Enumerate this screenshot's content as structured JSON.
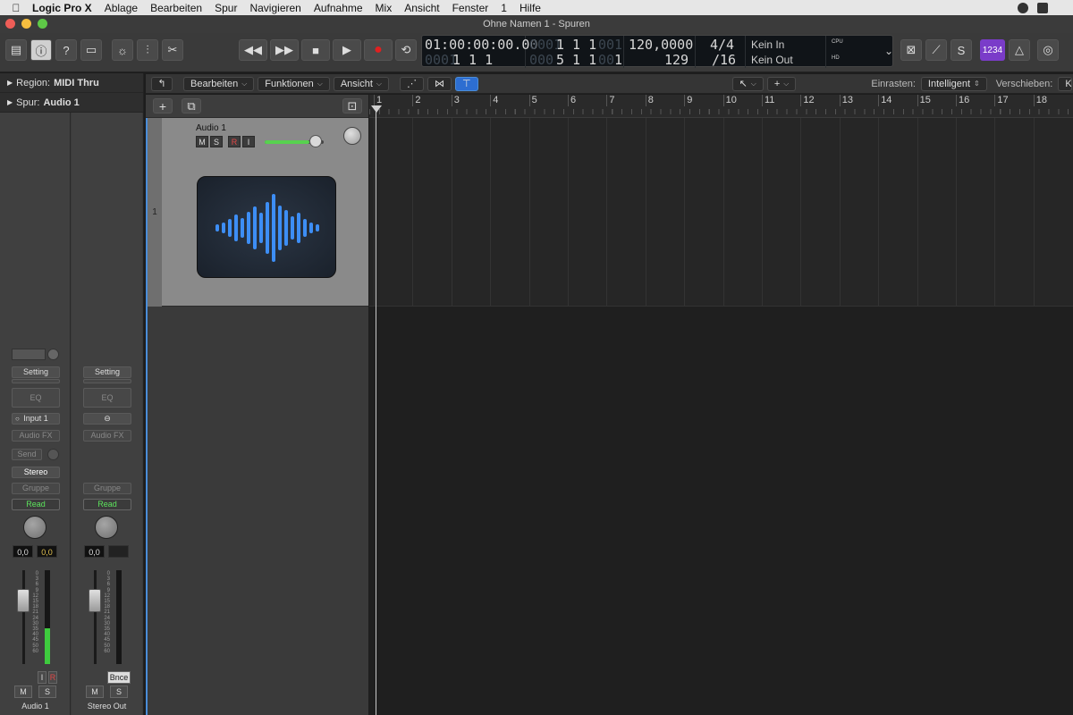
{
  "menubar": {
    "app_name": "Logic Pro X",
    "items": [
      "Ablage",
      "Bearbeiten",
      "Spur",
      "Navigieren",
      "Aufnahme",
      "Mix",
      "Ansicht",
      "Fenster",
      "1",
      "Hilfe"
    ]
  },
  "window": {
    "title": "Ohne Namen 1 - Spuren"
  },
  "lcd": {
    "timecode": "01:00:00:00.00",
    "position_top_dim": "0001",
    "position_top": "1  1  1",
    "position_top_sub": "001",
    "position_bottom": "1  1  1",
    "position_bottom_sub_dim": "00",
    "position_bottom_sub": "1",
    "end_bottom_dim": "000",
    "end_bottom": "5  1  1",
    "end_bottom_sub_dim": "00",
    "end_bottom_sub": "1",
    "tempo": "120,0000",
    "tempo_bottom": "129",
    "signature": "4/4",
    "division": "/16",
    "midi_in": "Kein In",
    "midi_out": "Kein Out",
    "cpu_label": "CPU",
    "hd_label": "HD"
  },
  "control_bar": {
    "count_in": "1234"
  },
  "inspector": {
    "region_label": "Region:",
    "region_value": "MIDI Thru",
    "track_label": "Spur:",
    "track_value": "Audio 1",
    "strip1": {
      "setting": "Setting",
      "eq": "EQ",
      "input": "Input 1",
      "audio_fx": "Audio FX",
      "send": "Send",
      "stereo": "Stereo",
      "group": "Gruppe",
      "automation": "Read",
      "value_left": "0,0",
      "value_right": "0,0",
      "input_monitor": "I",
      "record": "R",
      "mute": "M",
      "solo": "S",
      "name": "Audio 1"
    },
    "strip2": {
      "setting": "Setting",
      "eq": "EQ",
      "audio_fx": "Audio FX",
      "group": "Gruppe",
      "automation": "Read",
      "value_left": "0,0",
      "bounce": "Bnce",
      "mute": "M",
      "solo": "S",
      "name": "Stereo Out"
    },
    "meter_scale": [
      "0",
      "3",
      "6",
      "9",
      "12",
      "15",
      "18",
      "21",
      "24",
      "30",
      "35",
      "40",
      "45",
      "50",
      "60"
    ]
  },
  "tracks_toolbar": {
    "edit": "Bearbeiten",
    "functions": "Funktionen",
    "view": "Ansicht",
    "snap_label": "Einrasten:",
    "snap_value": "Intelligent",
    "drag_label": "Verschieben:",
    "drag_value": "Keine Üb"
  },
  "track": {
    "number": "1",
    "name": "Audio 1",
    "mute": "M",
    "solo": "S",
    "record": "R",
    "input": "I",
    "volume": 0.75
  },
  "ruler": {
    "bars": [
      "1",
      "2",
      "3",
      "4",
      "5",
      "6",
      "7",
      "8",
      "9",
      "10",
      "11",
      "12",
      "13",
      "14",
      "15",
      "16",
      "17",
      "18"
    ]
  },
  "colors": {
    "accent": "#4a8dd8",
    "record": "#e02020",
    "meter": "#3ecb3e",
    "waveform": "#3d8ef5",
    "count_in": "#7a3cc9"
  }
}
